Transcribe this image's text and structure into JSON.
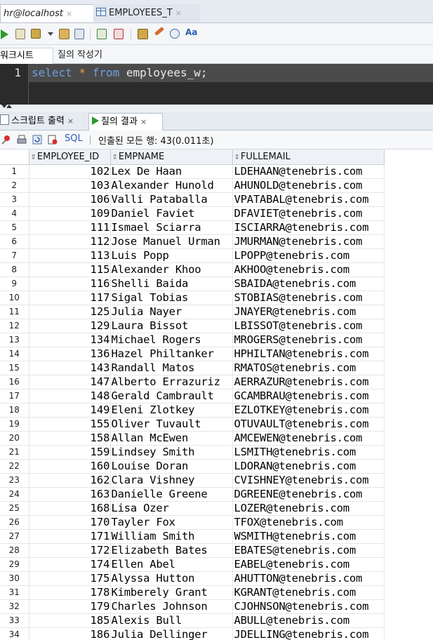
{
  "doc_tabs": [
    {
      "label": "hr@localhost",
      "close": "×"
    },
    {
      "label": "EMPLOYEES_T",
      "close": "×"
    }
  ],
  "editor_tabs": {
    "worksheet": "워크시트",
    "query_builder": "질의 작성기"
  },
  "editor": {
    "line_number": "1",
    "kw_select": "select",
    "star": "*",
    "kw_from": "from",
    "table": "employees_w;"
  },
  "output_tabs": [
    {
      "label": "스크립트 출력",
      "close": "×"
    },
    {
      "label": "질의 결과",
      "close": "×"
    }
  ],
  "result_toolbar": {
    "sql_label": "SQL",
    "status": "인출된 모든 행: 43(0.011초)"
  },
  "columns": [
    "EMPLOYEE_ID",
    "EMPNAME",
    "FULLEMAIL"
  ],
  "rows": [
    [
      "1",
      "102",
      "Lex De Haan",
      "LDEHAAN@tenebris.com"
    ],
    [
      "2",
      "103",
      "Alexander Hunold",
      "AHUNOLD@tenebris.com"
    ],
    [
      "3",
      "106",
      "Valli Pataballa",
      "VPATABAL@tenebris.com"
    ],
    [
      "4",
      "109",
      "Daniel Faviet",
      "DFAVIET@tenebris.com"
    ],
    [
      "5",
      "111",
      "Ismael Sciarra",
      "ISCIARRA@tenebris.com"
    ],
    [
      "6",
      "112",
      "Jose Manuel Urman",
      "JMURMAN@tenebris.com"
    ],
    [
      "7",
      "113",
      "Luis Popp",
      "LPOPP@tenebris.com"
    ],
    [
      "8",
      "115",
      "Alexander Khoo",
      "AKHOO@tenebris.com"
    ],
    [
      "9",
      "116",
      "Shelli Baida",
      "SBAIDA@tenebris.com"
    ],
    [
      "10",
      "117",
      "Sigal Tobias",
      "STOBIAS@tenebris.com"
    ],
    [
      "11",
      "125",
      "Julia Nayer",
      "JNAYER@tenebris.com"
    ],
    [
      "12",
      "129",
      "Laura Bissot",
      "LBISSOT@tenebris.com"
    ],
    [
      "13",
      "134",
      "Michael Rogers",
      "MROGERS@tenebris.com"
    ],
    [
      "14",
      "136",
      "Hazel Philtanker",
      "HPHILTAN@tenebris.com"
    ],
    [
      "15",
      "143",
      "Randall Matos",
      "RMATOS@tenebris.com"
    ],
    [
      "16",
      "147",
      "Alberto Errazuriz",
      "AERRAZUR@tenebris.com"
    ],
    [
      "17",
      "148",
      "Gerald Cambrault",
      "GCAMBRAU@tenebris.com"
    ],
    [
      "18",
      "149",
      "Eleni Zlotkey",
      "EZLOTKEY@tenebris.com"
    ],
    [
      "19",
      "155",
      "Oliver Tuvault",
      "OTUVAULT@tenebris.com"
    ],
    [
      "20",
      "158",
      "Allan McEwen",
      "AMCEWEN@tenebris.com"
    ],
    [
      "21",
      "159",
      "Lindsey Smith",
      "LSMITH@tenebris.com"
    ],
    [
      "22",
      "160",
      "Louise Doran",
      "LDORAN@tenebris.com"
    ],
    [
      "23",
      "162",
      "Clara Vishney",
      "CVISHNEY@tenebris.com"
    ],
    [
      "24",
      "163",
      "Danielle Greene",
      "DGREENE@tenebris.com"
    ],
    [
      "25",
      "168",
      "Lisa Ozer",
      "LOZER@tenebris.com"
    ],
    [
      "26",
      "170",
      "Tayler Fox",
      "TFOX@tenebris.com"
    ],
    [
      "27",
      "171",
      "William Smith",
      "WSMITH@tenebris.com"
    ],
    [
      "28",
      "172",
      "Elizabeth Bates",
      "EBATES@tenebris.com"
    ],
    [
      "29",
      "174",
      "Ellen Abel",
      "EABEL@tenebris.com"
    ],
    [
      "30",
      "175",
      "Alyssa Hutton",
      "AHUTTON@tenebris.com"
    ],
    [
      "31",
      "178",
      "Kimberely Grant",
      "KGRANT@tenebris.com"
    ],
    [
      "32",
      "179",
      "Charles Johnson",
      "CJOHNSON@tenebris.com"
    ],
    [
      "33",
      "185",
      "Alexis Bull",
      "ABULL@tenebris.com"
    ],
    [
      "34",
      "186",
      "Julia Dellinger",
      "JDELLING@tenebris.com"
    ]
  ],
  "icons": {
    "run": "run-statement-icon",
    "pin": "pin-icon",
    "print": "print-icon",
    "refresh": "refresh-icon",
    "export": "export-icon"
  },
  "colors": {
    "editor_bg": "#2b2b2b",
    "keyword": "#6f9fe0",
    "run_green": "#2d9a2d",
    "sql_blue": "#2a5db0"
  }
}
